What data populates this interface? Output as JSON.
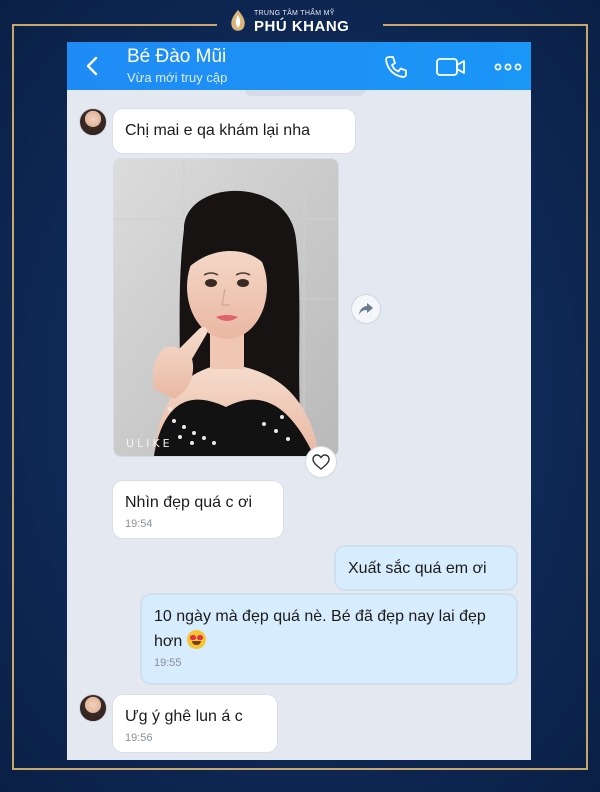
{
  "brand": {
    "subtitle": "TRUNG TÂM THẨM MỸ",
    "name": "PHÚ KHANG"
  },
  "header": {
    "contact_name": "Bé Đào Mũi",
    "status": "Vừa mới truy cập",
    "icons": [
      "back-icon",
      "phone-icon",
      "video-icon",
      "more-icon"
    ],
    "accent_color": "#1f8cf5"
  },
  "messages": [
    {
      "from": "contact",
      "text": "Chị mai e qa khám lại nha"
    },
    {
      "from": "contact",
      "type": "photo",
      "watermark": "ULIKE"
    },
    {
      "from": "contact",
      "text": "Nhìn đẹp quá c ơi",
      "time": "19:54"
    },
    {
      "from": "me",
      "text": "Xuất sắc quá em ơi"
    },
    {
      "from": "me",
      "text": "10 ngày mà đẹp quá nè. Bé đã đẹp nay lai đẹp hơn",
      "emoji": "heart-eyes",
      "time": "19:55"
    },
    {
      "from": "contact",
      "text": "Ưg ý ghê lun á c",
      "time": "19:56"
    }
  ]
}
